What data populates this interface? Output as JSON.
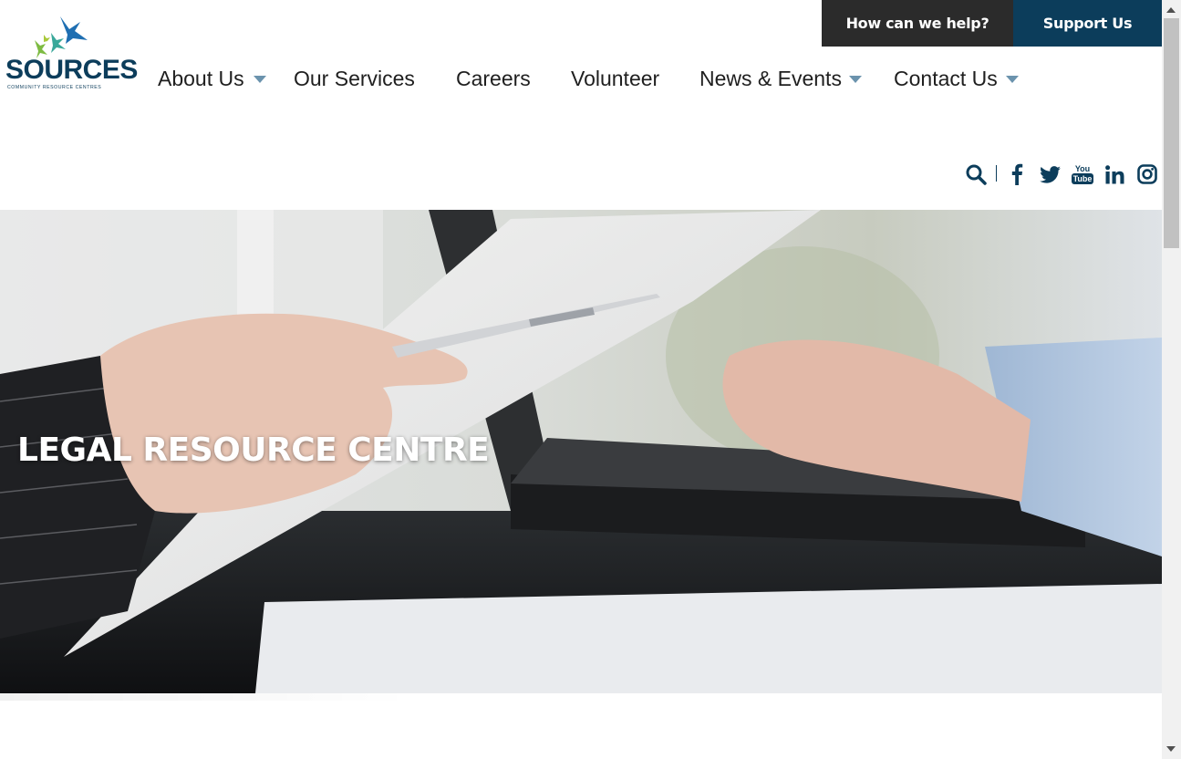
{
  "utility": {
    "help_label": "How can we help?",
    "support_label": "Support Us"
  },
  "logo": {
    "wordmark": "SOURCES",
    "tagline": "COMMUNITY RESOURCE CENTRES",
    "colors": {
      "blue": "#1f6fb2",
      "green": "#7dbb42",
      "teal": "#3aa89a",
      "navy": "#0c3d5b"
    }
  },
  "nav": {
    "items": [
      {
        "label": "About Us",
        "has_dropdown": true
      },
      {
        "label": "Our Services",
        "has_dropdown": false
      },
      {
        "label": "Careers",
        "has_dropdown": false
      },
      {
        "label": "Volunteer",
        "has_dropdown": false
      },
      {
        "label": "News & Events",
        "has_dropdown": true
      },
      {
        "label": "Contact Us",
        "has_dropdown": true
      }
    ]
  },
  "social": {
    "icons": [
      "search-icon",
      "facebook-icon",
      "twitter-icon",
      "youtube-icon",
      "linkedin-icon",
      "instagram-icon"
    ],
    "youtube_text_top": "You",
    "youtube_text_bottom": "Tube",
    "color": "#0c3d5b"
  },
  "hero": {
    "title": "LEGAL RESOURCE CENTRE"
  }
}
